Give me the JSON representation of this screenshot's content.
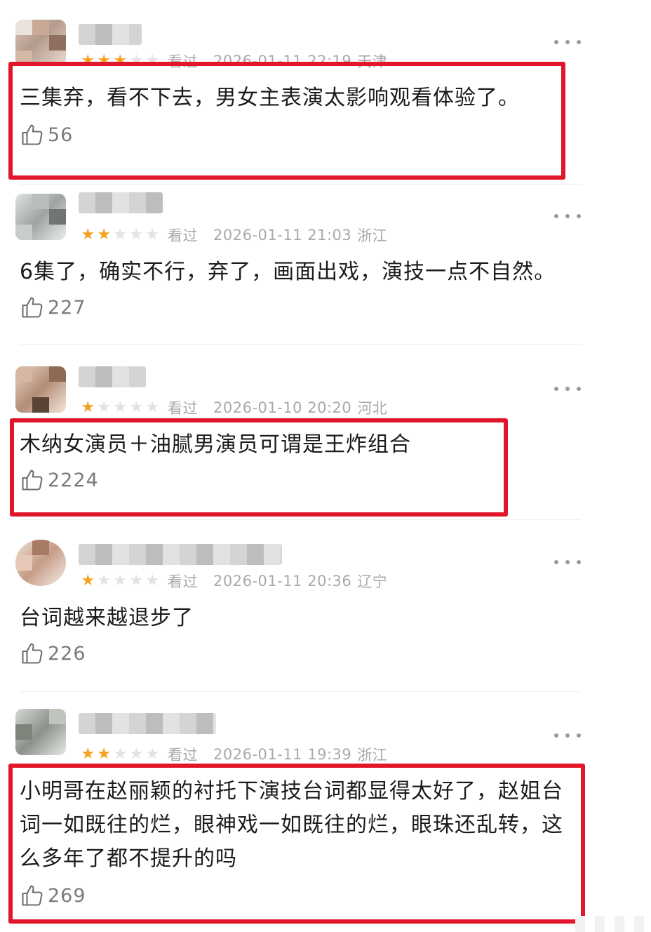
{
  "comments": [
    {
      "stars": 3,
      "seen": "看过",
      "date": "2026-01-11 22:19",
      "location": "天津",
      "text": "三集弃，看不下去，男女主表演太影响观看体验了。",
      "likes": "56"
    },
    {
      "stars": 2,
      "seen": "看过",
      "date": "2026-01-11 21:03",
      "location": "浙江",
      "text": "6集了，确实不行，弃了，画面出戏，演技一点不自然。",
      "likes": "227"
    },
    {
      "stars": 1,
      "seen": "看过",
      "date": "2026-01-10 20:20",
      "location": "河北",
      "text": "木纳女演员＋油腻男演员可谓是王炸组合",
      "likes": "2224"
    },
    {
      "stars": 1,
      "seen": "看过",
      "date": "2026-01-11 20:36",
      "location": "辽宁",
      "text": "台词越来越退步了",
      "likes": "226"
    },
    {
      "stars": 2,
      "seen": "看过",
      "date": "2026-01-11 19:39",
      "location": "浙江",
      "text": "小明哥在赵丽颖的衬托下演技台词都显得太好了，赵姐台词一如既往的烂，眼神戏一如既往的烂，眼珠还乱转，这么多年了都不提升的吗",
      "likes": "269"
    }
  ],
  "colors": {
    "highlight_box": "#e2162b",
    "star_active": "#f3a21d",
    "star_inactive": "#e2e2e2",
    "meta_text": "#a9a9a9"
  },
  "icons": {
    "like": "thumbs-up-icon",
    "more": "more-dots-icon",
    "star": "star-icon"
  }
}
